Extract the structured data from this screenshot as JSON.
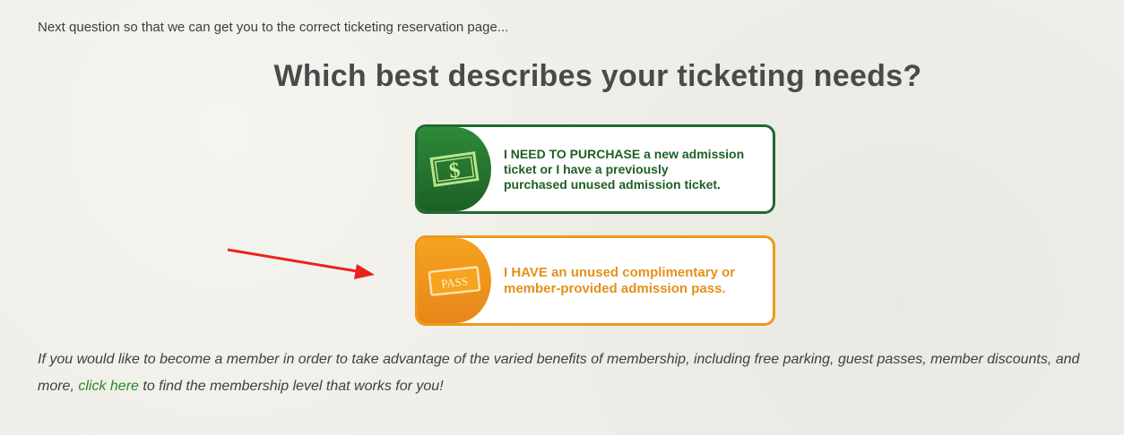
{
  "intro": "Next question so that we can get you to the correct ticketing reservation page...",
  "heading": "Which best describes your ticketing needs?",
  "options": [
    {
      "line1": "I NEED TO PURCHASE a new admission",
      "line2": "ticket or I have a previously",
      "line3": "purchased unused admission ticket.",
      "icon": "dollar-bill-icon",
      "color": "#1f6b2e"
    },
    {
      "line1": "I HAVE an unused complimentary or",
      "line2": "member-provided admission pass.",
      "icon_label": "PASS",
      "icon": "pass-ticket-icon",
      "color": "#ec9a18"
    }
  ],
  "outro": {
    "before": "If you would like to become a member in order to take advantage of the varied benefits of membership, including free parking, guest passes, member discounts, and more, ",
    "link": "click here",
    "after": " to find the membership level that works for you!"
  },
  "colors": {
    "arrow": "#e8231f",
    "link": "#2a8a2a"
  }
}
